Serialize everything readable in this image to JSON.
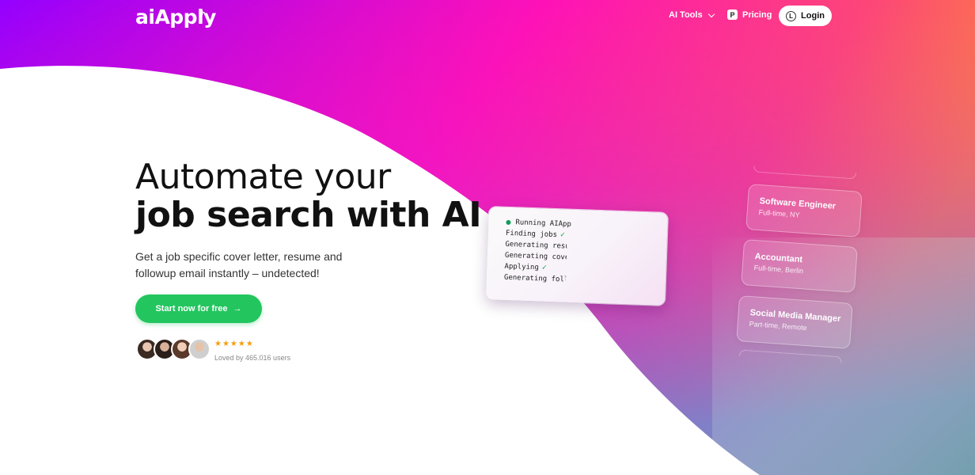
{
  "brand": {
    "name": "aiApply",
    "spark": "+"
  },
  "nav": {
    "ai_tools": "AI Tools",
    "pricing": "Pricing",
    "pricing_icon_letter": "P",
    "login": "Login",
    "login_icon_letter": "L"
  },
  "hero": {
    "line1": "Automate your",
    "line2_bold": "job search",
    "line2_rest": " with AI",
    "subtitle": "Get a job specific cover letter, resume and followup email instantly – undetected!",
    "cta_label": "Start now for free",
    "cta_arrow": "→",
    "stars": "★★★★★",
    "loved": "Loved by 465.016 users"
  },
  "terminal": {
    "lines": [
      {
        "text": "Running AIApp",
        "status_dot": true,
        "check": false
      },
      {
        "text": "Finding jobs",
        "status_dot": false,
        "check": true
      },
      {
        "text": "Generating resume",
        "status_dot": false,
        "check": false
      },
      {
        "text": "Generating cover",
        "status_dot": false,
        "check": false
      },
      {
        "text": "Applying",
        "status_dot": false,
        "check": true
      },
      {
        "text": "Generating followup",
        "status_dot": false,
        "check": false
      }
    ],
    "check_glyph": "✓"
  },
  "jobs": [
    {
      "title": "Software Engineer",
      "detail": "Full-time, NY"
    },
    {
      "title": "Accountant",
      "detail": "Full-time, Berlin"
    },
    {
      "title": "Social Media Manager",
      "detail": "Part-time, Remote"
    }
  ],
  "colors": {
    "cta": "#22c55e",
    "gradient_start": "#9b00ff",
    "gradient_mid": "#ff1fa8",
    "gradient_end": "#ff9a1a",
    "check": "#16a34a"
  }
}
